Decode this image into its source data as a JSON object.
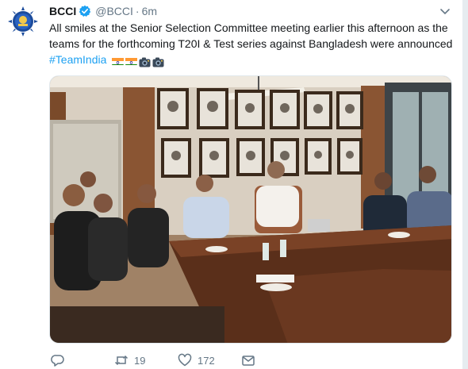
{
  "tweet": {
    "author_name": "BCCI",
    "author_handle": "@BCCI",
    "separator": "·",
    "timestamp": "6m",
    "text": "All smiles at the Senior Selection Committee meeting earlier this afternoon as the teams for the forthcoming T20I & Test series against Bangladesh were announced",
    "hashtag": "#TeamIndia",
    "emoji_icons": [
      "india-flag-icon",
      "india-flag-icon",
      "camera-icon",
      "camera-icon"
    ],
    "retweet_count": "19",
    "like_count": "172"
  },
  "icons": {
    "avatar": "bcci-logo-avatar",
    "verified": "verified-badge-icon",
    "caret": "chevron-down-icon",
    "reply": "reply-icon",
    "retweet": "retweet-icon",
    "like": "heart-icon",
    "share": "share-icon"
  },
  "colors": {
    "accent": "#1da1f2",
    "text_primary": "#14171a",
    "text_secondary": "#657786",
    "border": "#e1e8ed",
    "background": "#e6ecf0"
  }
}
